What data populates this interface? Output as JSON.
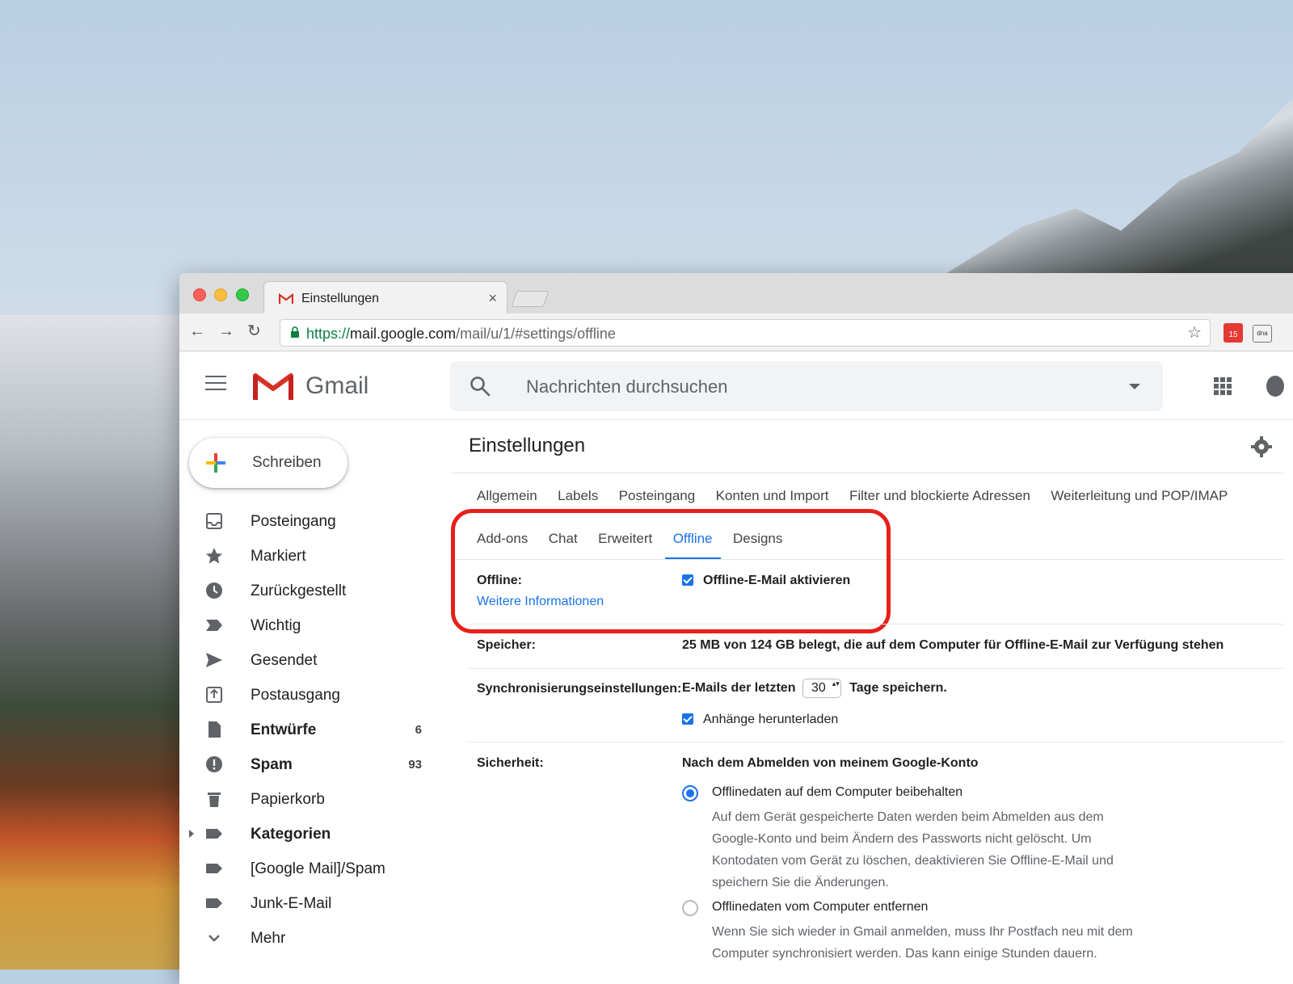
{
  "browser": {
    "tab_title": "Einstellungen",
    "url_scheme": "https://",
    "url_host": "mail.google.com",
    "url_path": "/mail/u/1/#settings/offline",
    "ext_calendar_badge": "15",
    "ext_second_label": "dna"
  },
  "header": {
    "app_name": "Gmail",
    "search_placeholder": "Nachrichten durchsuchen"
  },
  "sidebar": {
    "compose_label": "Schreiben",
    "items": [
      {
        "label": "Posteingang",
        "icon": "inbox-icon",
        "count": ""
      },
      {
        "label": "Markiert",
        "icon": "star-icon",
        "count": ""
      },
      {
        "label": "Zurückgestellt",
        "icon": "clock-icon",
        "count": ""
      },
      {
        "label": "Wichtig",
        "icon": "important-icon",
        "count": ""
      },
      {
        "label": "Gesendet",
        "icon": "send-icon",
        "count": ""
      },
      {
        "label": "Postausgang",
        "icon": "outbox-icon",
        "count": ""
      },
      {
        "label": "Entwürfe",
        "icon": "draft-icon",
        "count": "6"
      },
      {
        "label": "Spam",
        "icon": "spam-icon",
        "count": "93"
      },
      {
        "label": "Papierkorb",
        "icon": "trash-icon",
        "count": ""
      },
      {
        "label": "Kategorien",
        "icon": "label-icon",
        "count": ""
      },
      {
        "label": "[Google Mail]/Spam",
        "icon": "label-icon",
        "count": ""
      },
      {
        "label": "Junk-E-Mail",
        "icon": "label-icon",
        "count": ""
      },
      {
        "label": "Mehr",
        "icon": "chevron-down-icon",
        "count": ""
      }
    ]
  },
  "settings": {
    "title": "Einstellungen",
    "tabs_row1": [
      "Allgemein",
      "Labels",
      "Posteingang",
      "Konten und Import",
      "Filter und blockierte Adressen",
      "Weiterleitung und POP/IMAP"
    ],
    "tabs_row2": [
      "Add-ons",
      "Chat",
      "Erweitert",
      "Offline",
      "Designs"
    ],
    "active_tab": "Offline",
    "offline_label": "Offline:",
    "offline_link": "Weitere Informationen",
    "offline_checkbox": "Offline-E-Mail aktivieren",
    "storage_label": "Speicher:",
    "storage_value": "25 MB von 124 GB belegt, die auf dem Computer für Offline-E-Mail zur Verfügung stehen",
    "sync_label": "Synchronisierungseinstellungen:",
    "sync_prefix": "E-Mails der letzten",
    "sync_days": "30",
    "sync_suffix": "Tage speichern.",
    "attachments_checkbox": "Anhänge herunterladen",
    "security_label": "Sicherheit:",
    "security_heading": "Nach dem Abmelden von meinem Google-Konto",
    "option1_title": "Offlinedaten auf dem Computer beibehalten",
    "option1_desc": "Auf dem Gerät gespeicherte Daten werden beim Abmelden aus dem Google-Konto und beim Ändern des Passworts nicht gelöscht. Um Kontodaten vom Gerät zu löschen, deaktivieren Sie Offline-E-Mail und speichern Sie die Änderungen.",
    "option2_title": "Offlinedaten vom Computer entfernen",
    "option2_desc": "Wenn Sie sich wieder in Gmail anmelden, muss Ihr Postfach neu mit dem Computer synchronisiert werden. Das kann einige Stunden dauern."
  },
  "colors": {
    "accent": "#1a73e8",
    "highlight": "#e8201a"
  }
}
